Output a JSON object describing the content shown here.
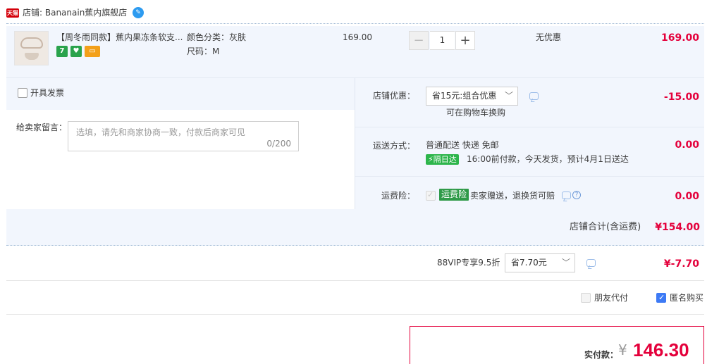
{
  "shop": {
    "badge": "天猫",
    "label": "店铺: Bananain蕉内旗舰店",
    "ww_icon": "wangwang-chat-icon"
  },
  "item": {
    "title": "【周冬雨同款】蕉内果冻条软支...",
    "color_option": "颜色分类：灰肤",
    "size_option": "尺码：M",
    "unit_price": "169.00",
    "quantity": "1",
    "minus": "−",
    "plus": "+",
    "discount": "无优惠",
    "subtotal": "169.00",
    "icon_7_label": "7"
  },
  "invoice": {
    "label": "开具发票"
  },
  "message": {
    "label": "给卖家留言：",
    "placeholder": "选填，请先和商家协商一致，付款后商家可见",
    "counter": "0/200"
  },
  "shop_discount": {
    "label": "店铺优惠：",
    "selected": "省15元:组合优惠",
    "note": "可在购物车换购",
    "amount": "-15.00"
  },
  "shipping": {
    "label": "运送方式：",
    "method": "普通配送 快递 免邮",
    "tag": "隔日达",
    "eta": "16:00前付款，今天发货，预计4月1日送达",
    "amount": "0.00"
  },
  "insurance": {
    "label": "运费险：",
    "tag": "运费险",
    "desc": "卖家赠送，退换货可赔",
    "amount": "0.00"
  },
  "store_total": {
    "label": "店铺合计(含运费)",
    "amount": "¥154.00"
  },
  "vip": {
    "label": "88VIP专享9.5折",
    "selected": "省7.70元",
    "amount": "¥-7.70"
  },
  "extras": {
    "friend_pay": "朋友代付",
    "anonymous": "匿名购买"
  },
  "payment": {
    "label": "实付款：",
    "currency": "¥",
    "amount": "146.30"
  },
  "colors": {
    "accent_red": "#e4003b",
    "row_bg": "#f2f6fd",
    "checkbox_blue": "#3d7af5",
    "green_tag": "#2db54b"
  }
}
